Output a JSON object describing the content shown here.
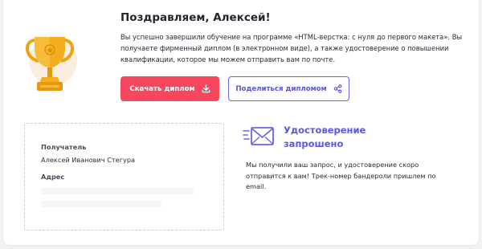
{
  "congrats": {
    "title": "Поздравляем, Алексей!",
    "description": "Вы успешно завершили обучение на программе «HTML-верстка: с нуля до первого макета». Вы получаете фирменный диплом (в электронном виде), а также удостоверение о повышении квалификации, которое мы можем отправить вам по почте."
  },
  "actions": {
    "download_label": "Скачать диплом",
    "share_label": "Поделиться дипломом"
  },
  "address_card": {
    "recipient_label": "Получатель",
    "recipient_value": "Алексей Иванович Стегура",
    "address_label": "Адрес"
  },
  "notice": {
    "title": "Удостоверение запрошено",
    "text": "Мы получили ваш запрос, и удостоверение скоро отправится к вам! Трек-номер бандероли пришлем по email."
  },
  "icons": {
    "trophy": "trophy-icon",
    "download": "download-icon",
    "share": "share-icon",
    "envelope": "envelope-icon"
  },
  "colors": {
    "accent_red": "#f7475f",
    "accent_purple": "#5d58d8",
    "trophy_gold": "#f2a516"
  }
}
